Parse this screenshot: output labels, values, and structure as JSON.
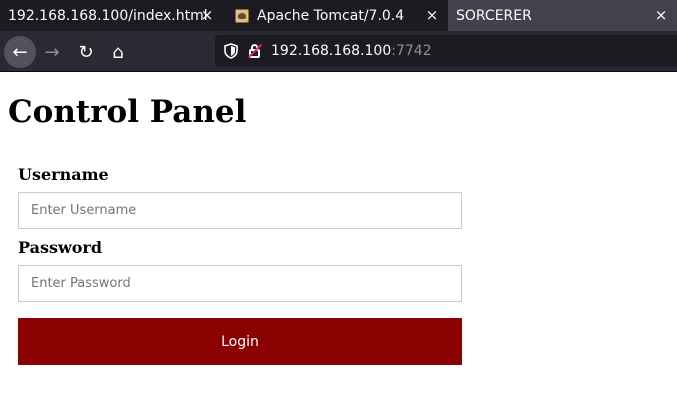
{
  "browser": {
    "tabs": [
      {
        "title": "192.168.168.100/index.html",
        "close_icon": "×"
      },
      {
        "title": "Apache Tomcat/7.0.4",
        "close_icon": "×",
        "favicon": "tomcat-icon"
      },
      {
        "title": "SORCERER",
        "close_icon": "×"
      }
    ],
    "nav": {
      "back_icon": "←",
      "forward_icon": "→",
      "reload_icon": "↻",
      "home_icon": "⌂",
      "shield_icon": "⛉"
    },
    "url": {
      "host": "192.168.168.100",
      "port": ":7742"
    }
  },
  "page": {
    "title": "Control Panel",
    "username_label": "Username",
    "username_placeholder": "Enter Username",
    "password_label": "Password",
    "password_placeholder": "Enter Password",
    "login_label": "Login",
    "button_color": "#8b0000"
  }
}
